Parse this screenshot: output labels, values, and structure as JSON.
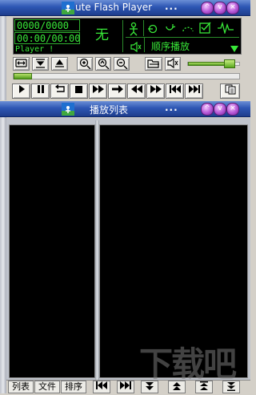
{
  "window": {
    "title": "ute Flash Player",
    "dots": "...",
    "buttons": [
      "^",
      "v",
      "×"
    ]
  },
  "display": {
    "frame_counter": "0000/0000",
    "time_counter": "00:00/00:00",
    "status": "Player !",
    "char": "无",
    "mode_label": "顺序播放"
  },
  "playlist_window": {
    "title": "播放列表",
    "dots": "...",
    "buttons": [
      "^",
      "v",
      "×"
    ]
  },
  "bottom_tabs": [
    "列表",
    "文件",
    "排序"
  ],
  "bottom_nav": [
    "⏮",
    "⏭"
  ],
  "watermark": "下载吧",
  "volume_level": 0.82,
  "seek_level": 0.08
}
